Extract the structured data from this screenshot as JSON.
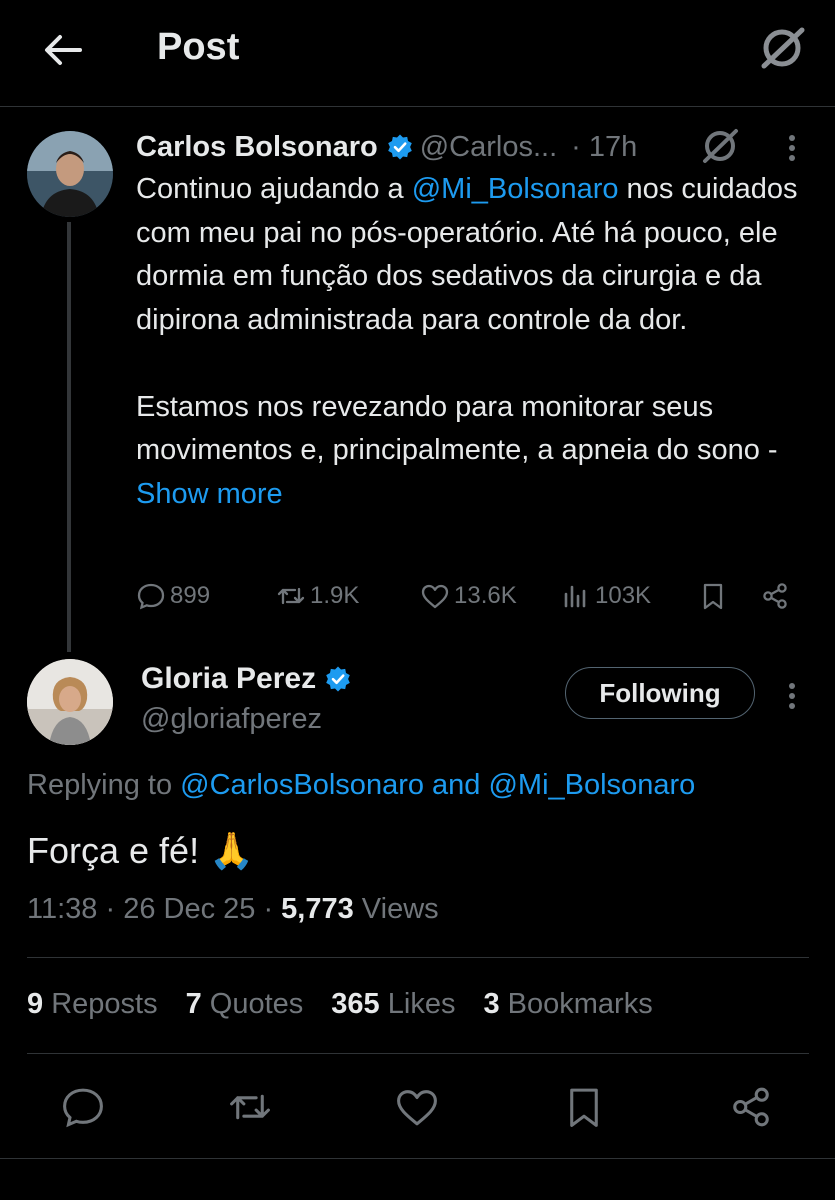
{
  "header": {
    "title": "Post"
  },
  "parent_tweet": {
    "name": "Carlos Bolsonaro",
    "handle": "@Carlos...",
    "time": "· 17h",
    "text_line1_prefix": "Continuo ajudando a ",
    "text_line1_mention": "@Mi_Bolsonaro",
    "text_line1_suffix": " nos cuidados com meu pai no pós-operatório. Até há pouco, ele dormia em função dos sedativos da cirurgia e da dipirona administrada para controle da dor.",
    "text_para2": "Estamos nos revezando para monitorar seus movimentos e, principalmente, a apneia do sono - ",
    "show_more": "Show more",
    "replies": "899",
    "reposts": "1.9K",
    "likes": "13.6K",
    "views": "103K"
  },
  "reply": {
    "name": "Gloria Perez",
    "handle": "@gloriafperez",
    "follow_label": "Following",
    "replying_prefix": "Replying to ",
    "replying_to": "@CarlosBolsonaro and @Mi_Bolsonaro",
    "text": "Força e fé! 🙏",
    "time": "11:38 · 26 Dec 25 · ",
    "views_count": "5,773",
    "views_label": " Views"
  },
  "stats": {
    "reposts_count": "9",
    "reposts_label": "Reposts",
    "quotes_count": "7",
    "quotes_label": "Quotes",
    "likes_count": "365",
    "likes_label": "Likes",
    "bookmarks_count": "3",
    "bookmarks_label": "Bookmarks"
  },
  "colors": {
    "background": "#000000",
    "text": "#e7e9ea",
    "muted": "#71767b",
    "accent": "#1d9bf0"
  },
  "icons": [
    "back-arrow-icon",
    "grok-icon",
    "verified-badge-icon",
    "more-icon",
    "reply-icon",
    "repost-icon",
    "like-icon",
    "views-icon",
    "bookmark-icon",
    "share-icon"
  ]
}
